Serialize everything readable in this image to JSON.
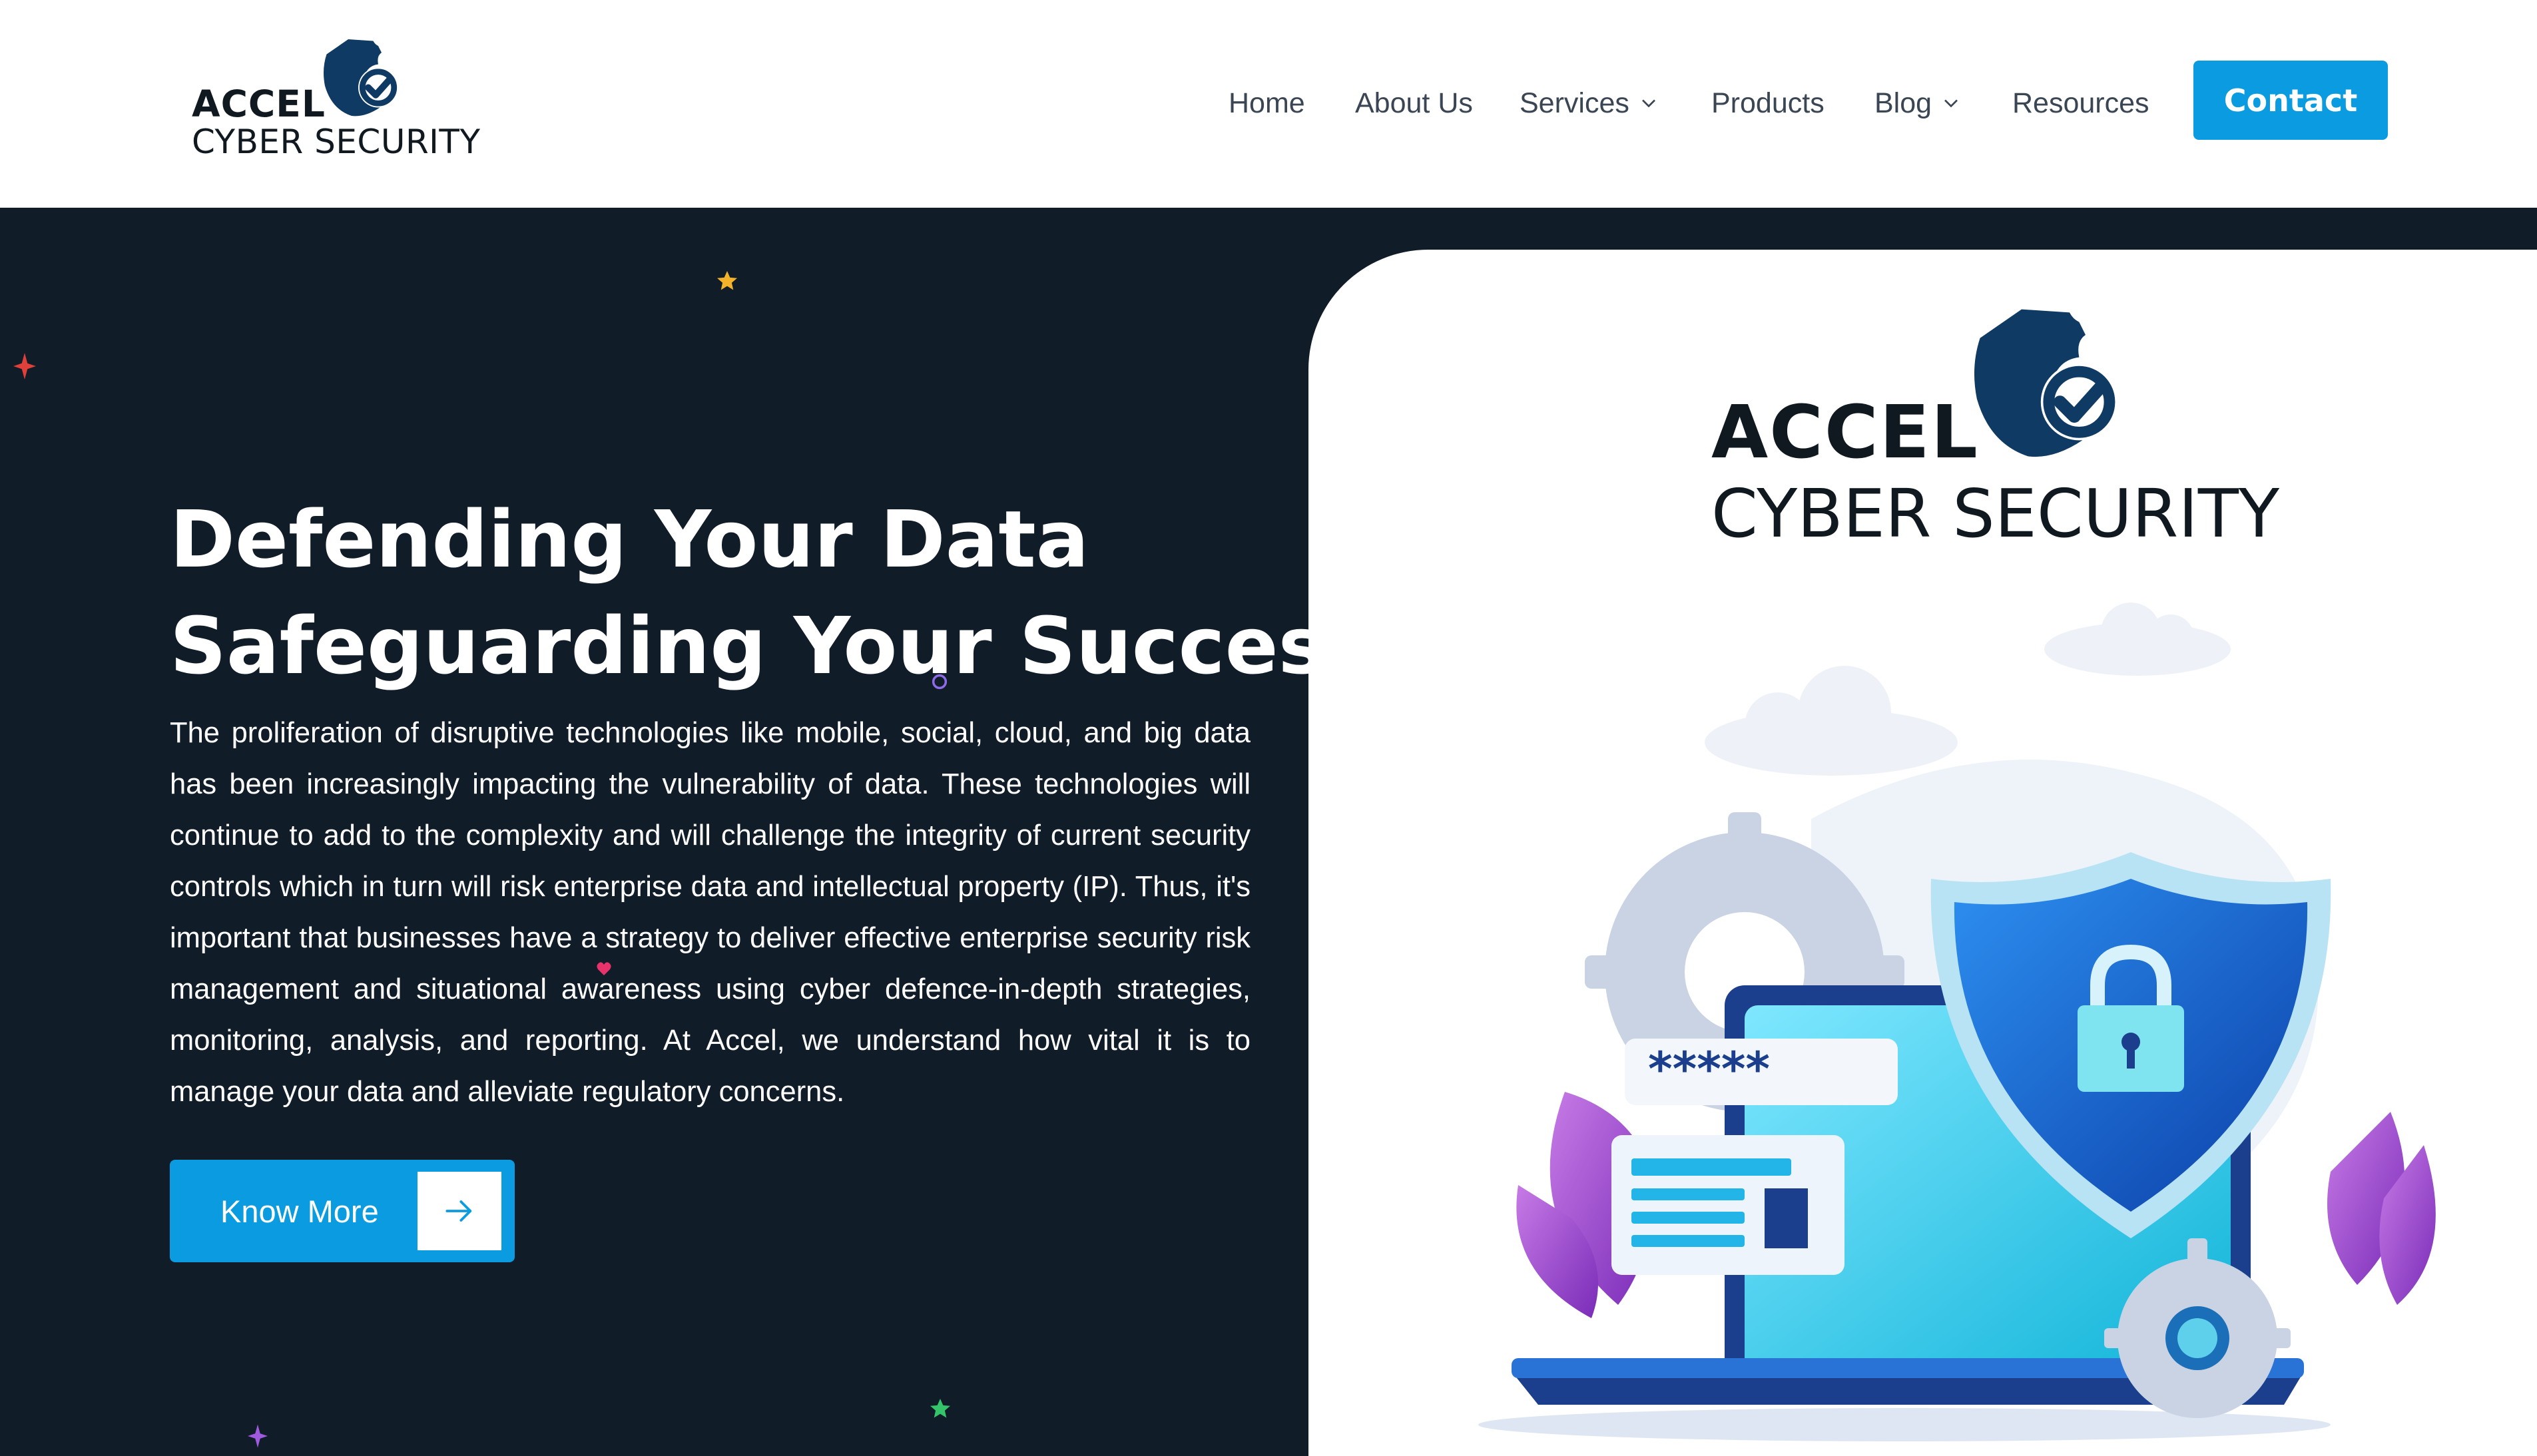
{
  "brand": {
    "line1": "ACCEL",
    "line2": "CYBER SECURITY"
  },
  "nav": {
    "items": [
      {
        "label": "Home",
        "has_dropdown": false
      },
      {
        "label": "About Us",
        "has_dropdown": false
      },
      {
        "label": "Services",
        "has_dropdown": true
      },
      {
        "label": "Products",
        "has_dropdown": false
      },
      {
        "label": "Blog",
        "has_dropdown": true
      },
      {
        "label": "Resources",
        "has_dropdown": false
      }
    ],
    "cta_label": "Contact"
  },
  "hero": {
    "headline_line1": "Defending Your Data",
    "headline_line2": "Safeguarding Your Success",
    "paragraph": "The proliferation of disruptive technologies like mobile, social, cloud, and big data has been increasingly impacting the vulnerability of data. These technologies will continue to add to the complexity and will challenge the integrity of current security controls which in turn will risk enterprise data and intellectual property (IP). Thus, it's important that businesses have a strategy to deliver effective enterprise security risk management and situational awareness using cyber defence-in-depth strategies, monitoring, analysis, and reporting. At Accel, we understand how vital it is to manage your data and alleviate regulatory concerns.",
    "button_label": "Know More"
  },
  "illustration": {
    "password_mask": "*****"
  },
  "colors": {
    "accent": "#0a9be0",
    "hero_bg": "#101c28",
    "logo_navy": "#0f3a63"
  },
  "icons": [
    "shield-check-icon",
    "chevron-down-icon",
    "arrow-right-icon",
    "padlock-icon",
    "gear-icon",
    "cloud-icon",
    "star-icon",
    "sparkle-icon",
    "heart-icon"
  ]
}
